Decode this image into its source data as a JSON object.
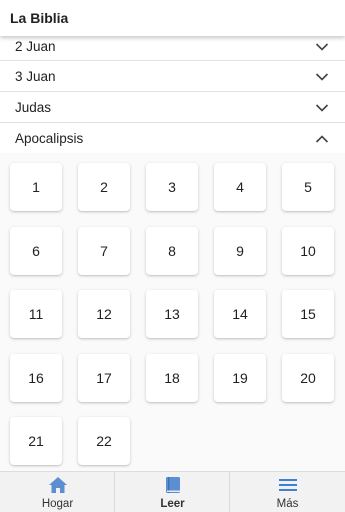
{
  "app_bar": {
    "title": "La Biblia"
  },
  "books": [
    {
      "label": "2 Juan",
      "expanded": false
    },
    {
      "label": "3 Juan",
      "expanded": false
    },
    {
      "label": "Judas",
      "expanded": false
    },
    {
      "label": "Apocalipsis",
      "expanded": true
    }
  ],
  "chapters": [
    "1",
    "2",
    "3",
    "4",
    "5",
    "6",
    "7",
    "8",
    "9",
    "10",
    "11",
    "12",
    "13",
    "14",
    "15",
    "16",
    "17",
    "18",
    "19",
    "20",
    "21",
    "22"
  ],
  "bottom_nav": {
    "items": [
      {
        "label": "Hogar",
        "icon": "home-icon",
        "active": false
      },
      {
        "label": "Leer",
        "icon": "book-icon",
        "active": true
      },
      {
        "label": "Más",
        "icon": "menu-icon",
        "active": false
      }
    ]
  },
  "colors": {
    "accent_blue": "#5b8fd1",
    "menu_blue": "#3f7fd6",
    "chevron": "#444444"
  }
}
